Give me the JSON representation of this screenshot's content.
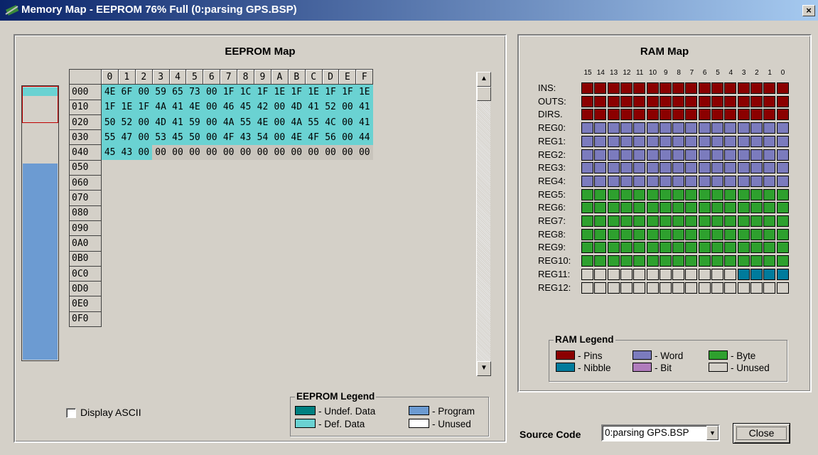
{
  "window": {
    "title": "Memory Map - EEPROM 76% Full (0:parsing GPS.BSP)",
    "close_glyph": "×"
  },
  "eeprom": {
    "title": "EEPROM Map",
    "columns": [
      "0",
      "1",
      "2",
      "3",
      "4",
      "5",
      "6",
      "7",
      "8",
      "9",
      "A",
      "B",
      "C",
      "D",
      "E",
      "F"
    ],
    "rows": [
      {
        "addr": "000",
        "cells": [
          "4E",
          "6F",
          "00",
          "59",
          "65",
          "73",
          "00",
          "1F",
          "1C",
          "1F",
          "1E",
          "1F",
          "1E",
          "1F",
          "1F",
          "1E"
        ]
      },
      {
        "addr": "010",
        "cells": [
          "1F",
          "1E",
          "1F",
          "4A",
          "41",
          "4E",
          "00",
          "46",
          "45",
          "42",
          "00",
          "4D",
          "41",
          "52",
          "00",
          "41"
        ]
      },
      {
        "addr": "020",
        "cells": [
          "50",
          "52",
          "00",
          "4D",
          "41",
          "59",
          "00",
          "4A",
          "55",
          "4E",
          "00",
          "4A",
          "55",
          "4C",
          "00",
          "41"
        ]
      },
      {
        "addr": "030",
        "cells": [
          "55",
          "47",
          "00",
          "53",
          "45",
          "50",
          "00",
          "4F",
          "43",
          "54",
          "00",
          "4E",
          "4F",
          "56",
          "00",
          "44"
        ]
      },
      {
        "addr": "040",
        "cells": [
          "45",
          "43",
          "00",
          "00",
          "00",
          "00",
          "00",
          "00",
          "00",
          "00",
          "00",
          "00",
          "00",
          "00",
          "00",
          "00"
        ]
      },
      {
        "addr": "050",
        "cells": []
      },
      {
        "addr": "060",
        "cells": []
      },
      {
        "addr": "070",
        "cells": []
      },
      {
        "addr": "080",
        "cells": []
      },
      {
        "addr": "090",
        "cells": []
      },
      {
        "addr": "0A0",
        "cells": []
      },
      {
        "addr": "0B0",
        "cells": []
      },
      {
        "addr": "0C0",
        "cells": []
      },
      {
        "addr": "0D0",
        "cells": []
      },
      {
        "addr": "0E0",
        "cells": []
      },
      {
        "addr": "0F0",
        "cells": []
      }
    ],
    "defined_count": 67,
    "usage_percent": 76,
    "display_ascii_label": "Display ASCII",
    "display_ascii_checked": false,
    "legend": {
      "title": "EEPROM Legend",
      "items": [
        {
          "label": "- Undef. Data",
          "color": "#008080"
        },
        {
          "label": "- Program",
          "color": "#6c9bd2"
        },
        {
          "label": "- Def. Data",
          "color": "#6ad2d2"
        },
        {
          "label": "- Unused",
          "color": "#ffffff"
        }
      ]
    }
  },
  "ram": {
    "title": "RAM Map",
    "bits": [
      "15",
      "14",
      "13",
      "12",
      "11",
      "10",
      "9",
      "8",
      "7",
      "6",
      "5",
      "4",
      "3",
      "2",
      "1",
      "0"
    ],
    "rows": [
      {
        "label": "INS:",
        "type": "pins"
      },
      {
        "label": "OUTS:",
        "type": "pins"
      },
      {
        "label": "DIRS.",
        "type": "pins"
      },
      {
        "label": "REG0:",
        "type": "word"
      },
      {
        "label": "REG1:",
        "type": "word"
      },
      {
        "label": "REG2:",
        "type": "word"
      },
      {
        "label": "REG3:",
        "type": "word"
      },
      {
        "label": "REG4:",
        "type": "word"
      },
      {
        "label": "REG5:",
        "type": "byte"
      },
      {
        "label": "REG6:",
        "type": "byte"
      },
      {
        "label": "REG7:",
        "type": "byte"
      },
      {
        "label": "REG8:",
        "type": "byte"
      },
      {
        "label": "REG9:",
        "type": "byte"
      },
      {
        "label": "REG10:",
        "type": "byte"
      },
      {
        "label": "REG11:",
        "type": "mixed",
        "nibble_bits": 4
      },
      {
        "label": "REG12:",
        "type": "unused"
      }
    ],
    "colors": {
      "pins": "#8b0000",
      "word": "#7b7bbd",
      "byte": "#2ea02e",
      "nibble": "#007b9c",
      "bit": "#b07cbc",
      "unused": "#d4d0c8"
    },
    "legend": {
      "title": "RAM Legend",
      "items": [
        {
          "label": "- Pins",
          "color": "#8b0000"
        },
        {
          "label": "- Word",
          "color": "#7b7bbd"
        },
        {
          "label": "- Byte",
          "color": "#2ea02e"
        },
        {
          "label": "- Nibble",
          "color": "#007b9c"
        },
        {
          "label": "- Bit",
          "color": "#b07cbc"
        },
        {
          "label": "- Unused",
          "color": "#d4d0c8"
        }
      ]
    }
  },
  "footer": {
    "source_code_label": "Source Code",
    "source_code_value": "0:parsing GPS.BSP",
    "close_label": "Close"
  }
}
